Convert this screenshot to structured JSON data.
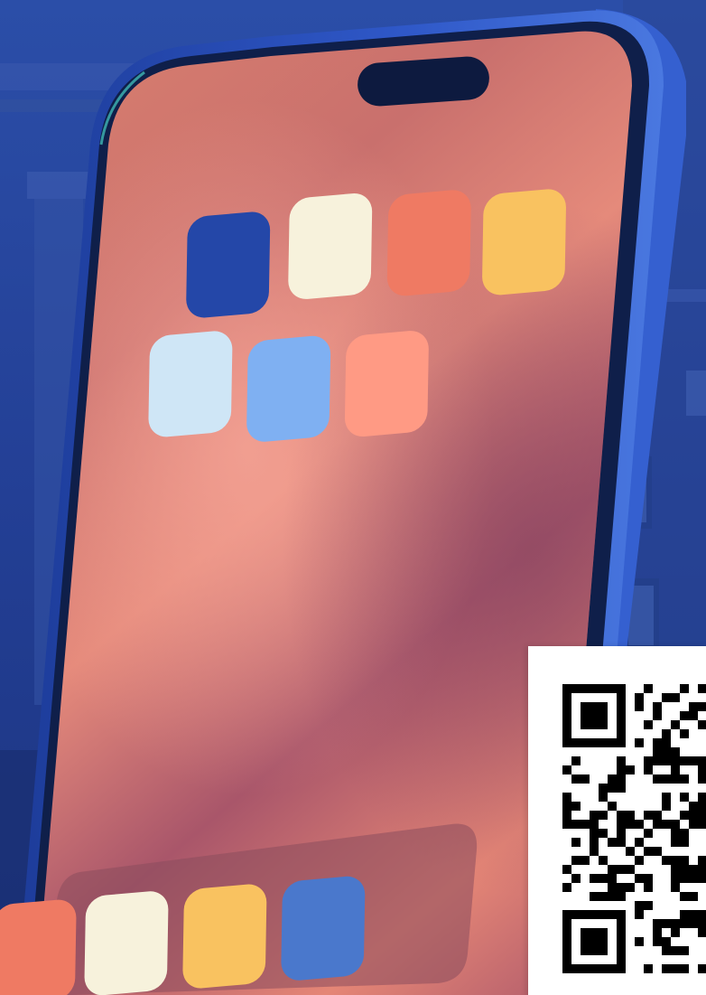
{
  "scene": {
    "background_tint": "#22409a",
    "phone_frame_color": "#2f58c8",
    "screen_gradient": [
      "#e7836f",
      "#b9616a",
      "#a8566a"
    ]
  },
  "home_screen": {
    "app_rows": [
      [
        {
          "name": "app-icon-blue",
          "color": "#2447a8"
        },
        {
          "name": "app-icon-cream",
          "color": "#f7f2dc"
        },
        {
          "name": "app-icon-coral",
          "color": "#ef7a63"
        },
        {
          "name": "app-icon-yellow",
          "color": "#f9c260"
        }
      ],
      [
        {
          "name": "app-icon-pale-blue",
          "color": "#cfe6f6"
        },
        {
          "name": "app-icon-sky-blue",
          "color": "#7fb0f2"
        },
        {
          "name": "app-icon-peach",
          "color": "#ff9a84"
        }
      ]
    ],
    "dock": [
      {
        "name": "dock-icon-coral",
        "color": "#ef7a63"
      },
      {
        "name": "dock-icon-cream",
        "color": "#f7f2dc"
      },
      {
        "name": "dock-icon-yellow",
        "color": "#f9c260"
      },
      {
        "name": "dock-icon-blue",
        "color": "#4a78cc"
      }
    ]
  },
  "qr": {
    "icon": "qr-code-icon"
  }
}
